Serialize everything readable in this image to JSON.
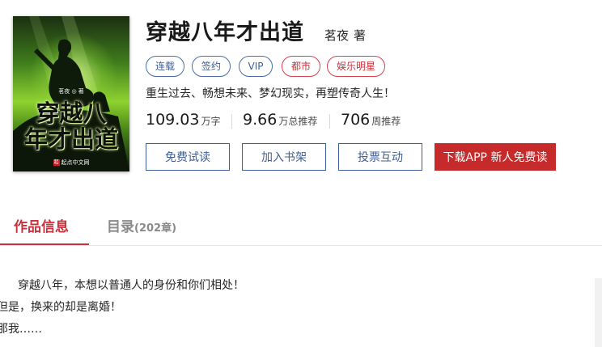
{
  "book": {
    "title": "穿越八年才出道",
    "author": "茗夜",
    "author_suffix": "著",
    "intro": "重生过去、畅想未来、梦幻现实，再塑传奇人生！"
  },
  "cover": {
    "author_line": "茗夜 ◎ 著",
    "title_line1": "穿越八",
    "title_line2": "年才出道",
    "publisher_logo": "起",
    "publisher": "起点中文网"
  },
  "tags": [
    {
      "label": "连载",
      "style": "blue"
    },
    {
      "label": "签约",
      "style": "blue"
    },
    {
      "label": "VIP",
      "style": "blue"
    },
    {
      "label": "都市",
      "style": "red"
    },
    {
      "label": "娱乐明星",
      "style": "red"
    }
  ],
  "stats": [
    {
      "value": "109.03",
      "unit": "万字"
    },
    {
      "value": "9.66",
      "unit": "万总推荐"
    },
    {
      "value": "706",
      "unit": "周推荐"
    }
  ],
  "buttons": {
    "free_read": "免费试读",
    "add_shelf": "加入书架",
    "vote": "投票互动",
    "download": "下载APP 新人免费读"
  },
  "tabs": {
    "info": "作品信息",
    "catalog": "目录",
    "catalog_count": "(202章)"
  },
  "description": [
    "穿越八年，本想以普通人的身份和你们相处！",
    "但是，换来的却是离婚！",
    "那我……"
  ],
  "colors": {
    "accent_red": "#c9323c",
    "accent_blue": "#3e5f96",
    "download_button": "#c72a2a"
  }
}
